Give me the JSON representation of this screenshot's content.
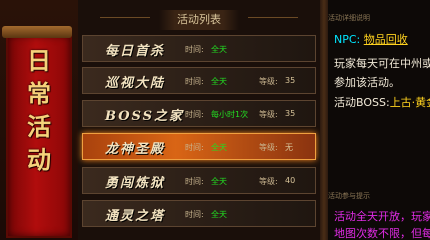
{
  "banner": {
    "title_chars": [
      "日",
      "常",
      "活",
      "动"
    ]
  },
  "list": {
    "header": "活动列表",
    "rows": [
      {
        "name": "每日首杀",
        "time_label": "时间:",
        "time_value": "全天",
        "level_label": "",
        "level_value": ""
      },
      {
        "name": "巡视大陆",
        "time_label": "时间:",
        "time_value": "全天",
        "level_label": "等级:",
        "level_value": "35"
      },
      {
        "name": "BOSS之家",
        "time_label": "时间:",
        "time_value": "每小时1次",
        "level_label": "等级:",
        "level_value": "35"
      },
      {
        "name": "龙神圣殿",
        "time_label": "时间:",
        "time_value": "全天",
        "level_label": "等级:",
        "level_value": "无"
      },
      {
        "name": "勇闯炼狱",
        "time_label": "时间:",
        "time_value": "全天",
        "level_label": "等级:",
        "level_value": "40"
      },
      {
        "name": "通灵之塔",
        "time_label": "时间:",
        "time_value": "全天",
        "level_label": "",
        "level_value": ""
      }
    ],
    "selected_index": 3
  },
  "detail": {
    "section1_title": "活动详细说明",
    "npc_prefix": "NPC:",
    "npc_name": "物品回收",
    "desc_line1": "玩家每天可在中州或",
    "desc_line2": "参加该活动。",
    "boss_prefix": "活动BOSS:",
    "boss_value": "上古·黄金",
    "section2_title": "活动参与提示",
    "tip_line1": "活动全天开放，玩家",
    "tip_line2": "地图次数不限，但每"
  },
  "colors": {
    "banner_red": "#b10d0d",
    "selected_orange": "#d96515",
    "time_green": "#22dd22",
    "npc_cyan": "#00e5ff",
    "gold": "#ffd21f",
    "tip_magenta": "#e12ce6"
  }
}
